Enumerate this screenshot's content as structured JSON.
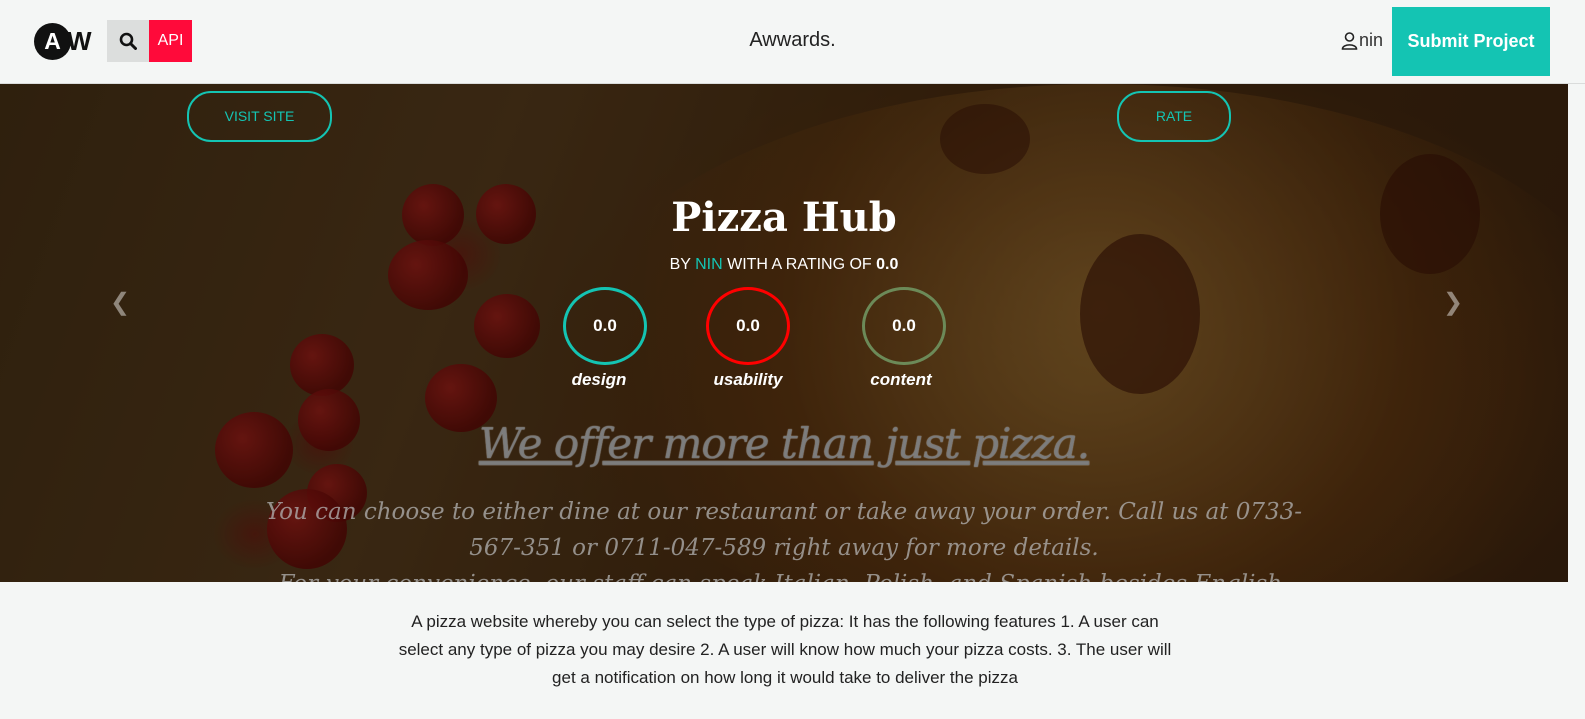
{
  "header": {
    "logo_letter": "A",
    "logo_suffix": "W",
    "api_label": "API",
    "brand": "Awwards.",
    "username": "nin",
    "submit_label": "Submit Project"
  },
  "hero": {
    "visit_label": "VISIT SITE",
    "rate_label": "RATE",
    "title": "Pizza Hub",
    "by_text": "BY",
    "author": "NIN",
    "rating_text": "WITH A RATING OF",
    "rating": "0.0",
    "scores": [
      {
        "label": "design",
        "value": "0.0",
        "color": "#14c4b3"
      },
      {
        "label": "usability",
        "value": "0.0",
        "color": "#ff0000"
      },
      {
        "label": "content",
        "value": "0.0",
        "color": "#6c8a58"
      }
    ],
    "tagline": "We offer more than just pizza.",
    "paragraph": "You can choose to either dine at our restaurant or take away your order. Call us at 0733-567-351 or 0711-047-589 right away for more details.",
    "paragraph2": "For your convenience, our staff can speak Italian, Polish, and Spanish besides English."
  },
  "description": "A pizza website whereby you can select the type of pizza: It has the following features 1. A user can select any type of pizza you may desire 2. A user will know how much your pizza costs. 3. The user will get a notification on how long it would take to deliver the pizza",
  "colors": {
    "accent": "#14c4b3",
    "api": "#ff0a3a",
    "usability": "#ff0000",
    "content": "#6c8a58"
  }
}
